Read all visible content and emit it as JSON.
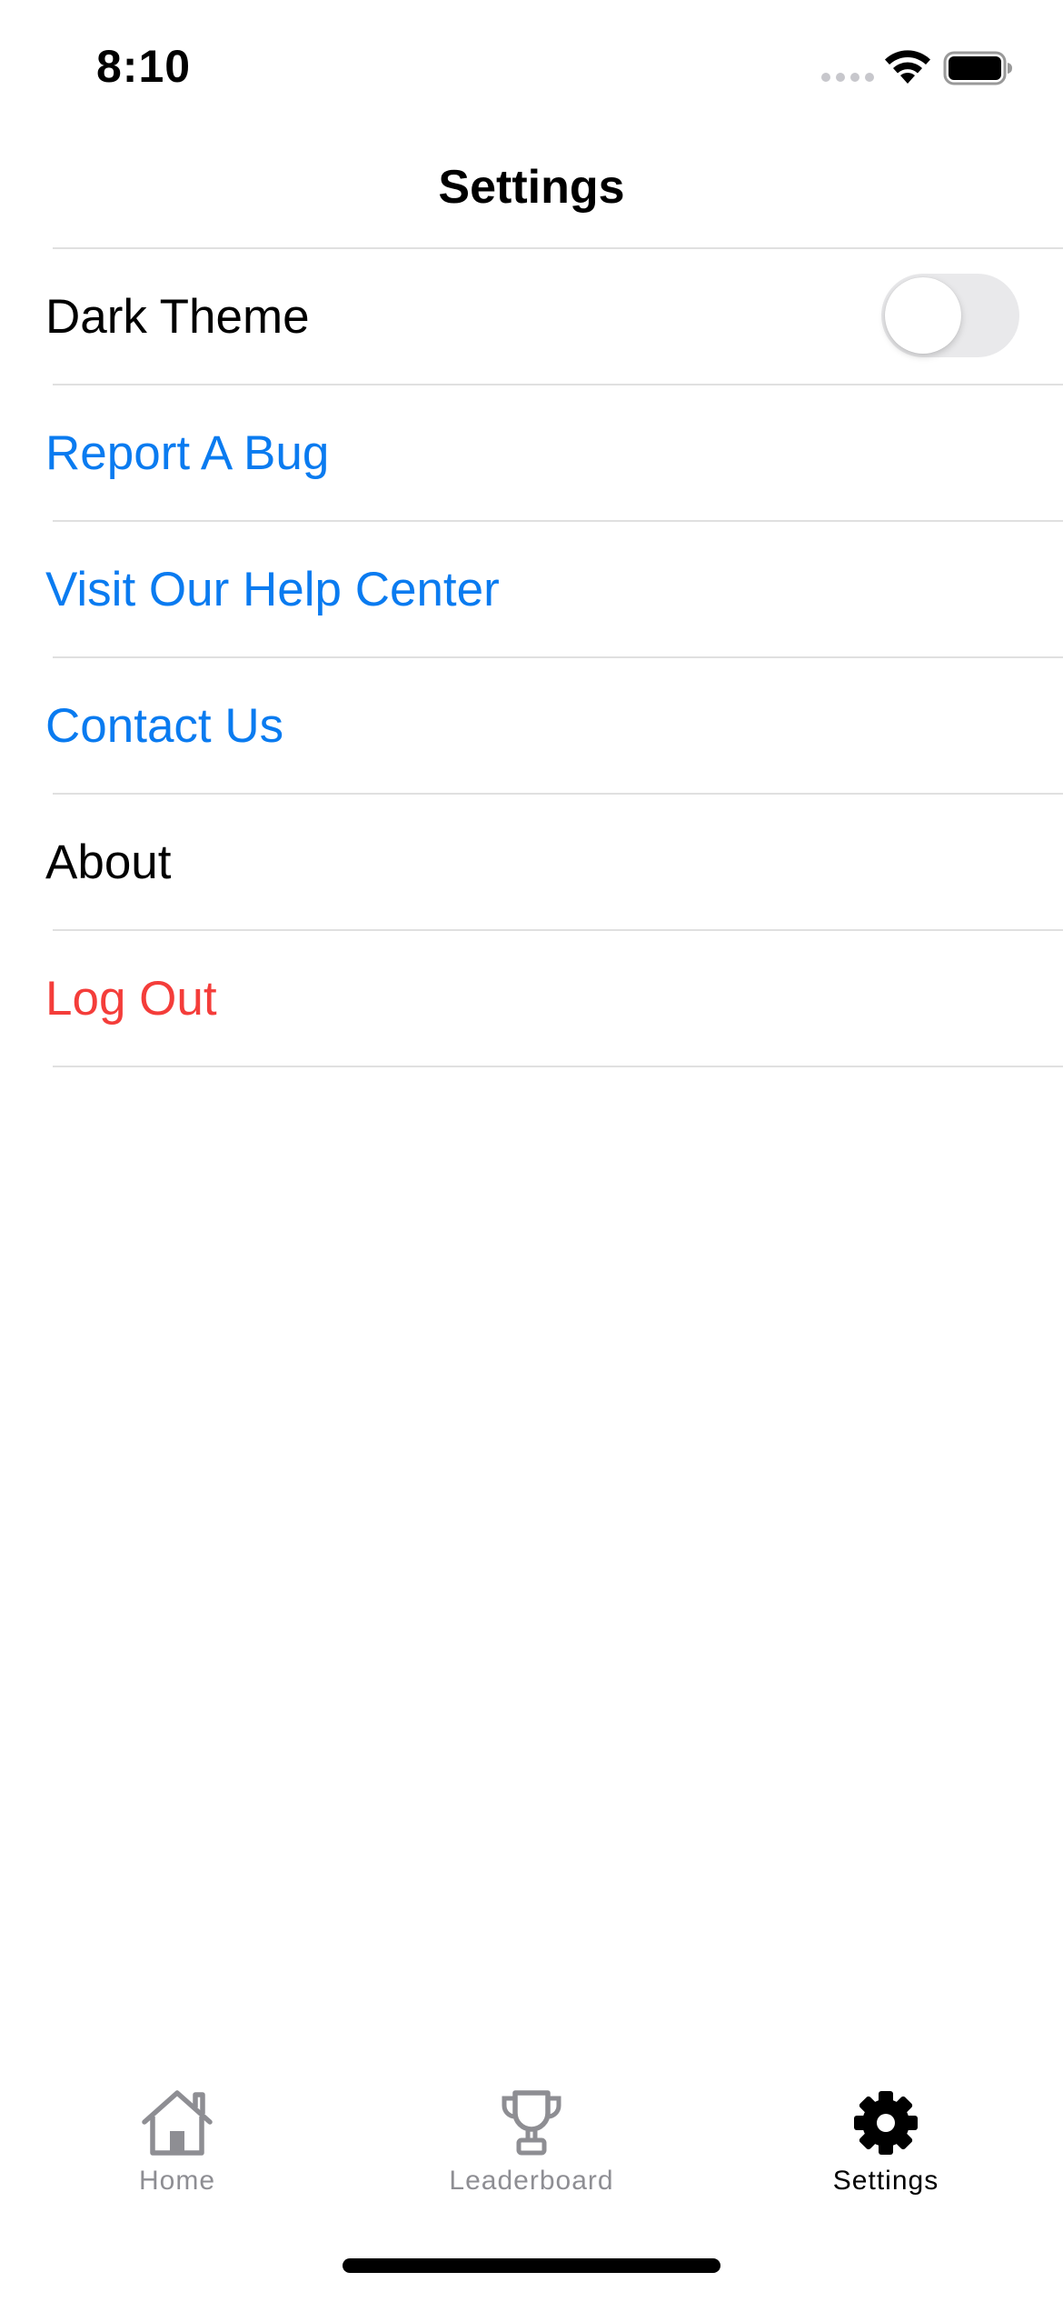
{
  "status_bar": {
    "time": "8:10"
  },
  "nav": {
    "title": "Settings"
  },
  "settings": {
    "dark_theme": {
      "label": "Dark Theme",
      "enabled": false
    },
    "report_bug": "Report A Bug",
    "help_center": "Visit Our Help Center",
    "contact_us": "Contact Us",
    "about": "About",
    "log_out": "Log Out"
  },
  "tabs": [
    {
      "label": "Home",
      "icon": "home-icon",
      "active": false
    },
    {
      "label": "Leaderboard",
      "icon": "trophy-icon",
      "active": false
    },
    {
      "label": "Settings",
      "icon": "gear-icon",
      "active": true
    }
  ],
  "colors": {
    "link_blue": "#0a7bf0",
    "destructive_red": "#f43d3a",
    "inactive_gray": "#8e8e93"
  }
}
